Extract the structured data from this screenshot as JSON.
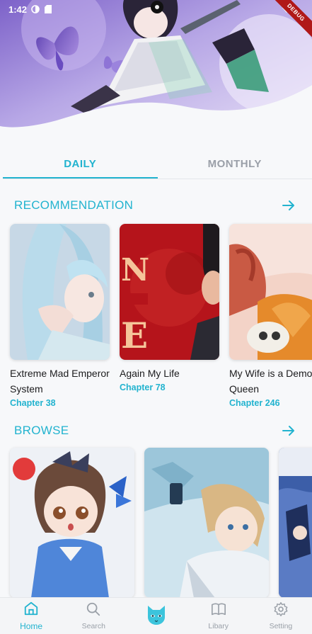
{
  "status_bar": {
    "time": "1:42"
  },
  "debug_banner": "DEBUG",
  "tabs": [
    {
      "label": "DAILY",
      "active": true
    },
    {
      "label": "MONTHLY",
      "active": false
    }
  ],
  "recommendation": {
    "title": "RECOMMENDATION",
    "items": [
      {
        "title": "Extreme Mad Emperor System",
        "chapter": "Chapter 38"
      },
      {
        "title": "Again My Life",
        "chapter": "Chapter 78"
      },
      {
        "title": "My Wife is a Demon Queen",
        "chapter": "Chapter 246"
      }
    ]
  },
  "browse": {
    "title": "BROWSE"
  },
  "bottom_nav": [
    {
      "label": "Home",
      "icon": "home-icon",
      "active": true
    },
    {
      "label": "Search",
      "icon": "search-icon",
      "active": false
    },
    {
      "label": "",
      "icon": "cat-logo-icon",
      "active": false
    },
    {
      "label": "Libary",
      "icon": "book-icon",
      "active": false
    },
    {
      "label": "Setting",
      "icon": "gear-icon",
      "active": false
    }
  ],
  "colors": {
    "accent": "#22b3cf",
    "inactive": "#9aa0a8",
    "background": "#f7f8fa"
  }
}
